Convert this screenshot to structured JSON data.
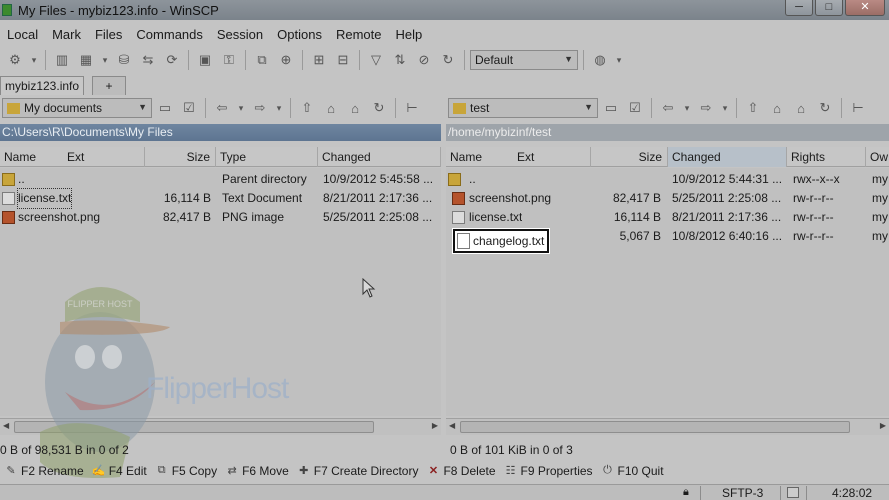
{
  "window": {
    "title": "My Files - mybiz123.info - WinSCP",
    "minimize": "─",
    "maximize": "□",
    "close": "✕"
  },
  "menu": [
    "Local",
    "Mark",
    "Files",
    "Commands",
    "Session",
    "Options",
    "Remote",
    "Help"
  ],
  "toolbar": {
    "transfer_preset": "Default"
  },
  "session_tabs": [
    {
      "label": "mybiz123.info"
    },
    {
      "label": "+"
    }
  ],
  "left_panel": {
    "location": "My documents",
    "path": "C:\\Users\\R\\Documents\\My Files",
    "columns": [
      "Name",
      "Ext",
      "Size",
      "Type",
      "Changed"
    ],
    "rows": [
      {
        "name": "..",
        "size": "",
        "type": "Parent directory",
        "changed": "10/9/2012  5:45:58 ...",
        "icon": "up-folder-icon"
      },
      {
        "name": "license.txt",
        "size": "16,114 B",
        "type": "Text Document",
        "changed": "8/21/2011  2:17:36 ...",
        "icon": "text-file-icon"
      },
      {
        "name": "screenshot.png",
        "size": "82,417 B",
        "type": "PNG image",
        "changed": "5/25/2011  2:25:08 ...",
        "icon": "image-file-icon"
      }
    ],
    "status": "0 B of 98,531 B in 0 of 2"
  },
  "right_panel": {
    "location": "test",
    "path": "/home/mybizinf/test",
    "columns": [
      "Name",
      "Ext",
      "Size",
      "Changed",
      "Rights",
      "Ow"
    ],
    "rows": [
      {
        "name": "..",
        "size": "",
        "changed": "10/9/2012  5:44:31 ...",
        "rights": "rwx--x--x",
        "owner": "my",
        "icon": "up-folder-icon"
      },
      {
        "name": "screenshot.png",
        "size": "82,417 B",
        "changed": "5/25/2011  2:25:08 ...",
        "rights": "rw-r--r--",
        "owner": "my",
        "icon": "image-file-icon"
      },
      {
        "name": "license.txt",
        "size": "16,114 B",
        "changed": "8/21/2011  2:17:36 ...",
        "rights": "rw-r--r--",
        "owner": "my",
        "icon": "text-file-icon"
      },
      {
        "name": "changelog.txt",
        "size": "5,067 B",
        "changed": "10/8/2012  6:40:16 ...",
        "rights": "rw-r--r--",
        "owner": "my",
        "icon": "text-file-icon"
      }
    ],
    "status": "0 B of 101 KiB in 0 of 3"
  },
  "fkeys": [
    {
      "label": "F2 Rename",
      "icon": "rename-icon"
    },
    {
      "label": "F4 Edit",
      "icon": "edit-icon"
    },
    {
      "label": "F5 Copy",
      "icon": "copy-icon"
    },
    {
      "label": "F6 Move",
      "icon": "move-icon"
    },
    {
      "label": "F7 Create Directory",
      "icon": "create-directory-icon"
    },
    {
      "label": "F8 Delete",
      "icon": "delete-icon"
    },
    {
      "label": "F9 Properties",
      "icon": "properties-icon"
    },
    {
      "label": "F10 Quit",
      "icon": "quit-icon"
    }
  ],
  "statusbar": {
    "protocol": "SFTP-3",
    "time": "4:28:02"
  },
  "watermark": {
    "text": "FlipperHost",
    "cap_text": "FLIPPER HOST"
  }
}
